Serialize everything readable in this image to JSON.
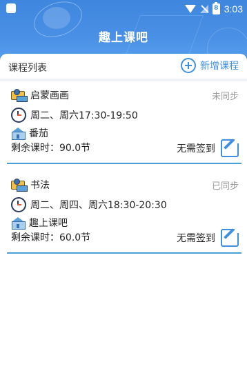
{
  "status_bar": {
    "time": "3:03",
    "battery_level": "8"
  },
  "header": {
    "title": "趣上课吧"
  },
  "list": {
    "title": "课程列表",
    "add_label": "新增课程"
  },
  "courses": [
    {
      "name": "启蒙画画",
      "sync_status": "未同步",
      "schedule": "周二、周六17:30-19:50",
      "school": "番茄",
      "remaining": "剩余课时：90.0节",
      "sign_label": "无需签到"
    },
    {
      "name": "书法",
      "sync_status": "已同步",
      "schedule": "周二、周四、周六18:30-20:30",
      "school": "趣上课吧",
      "remaining": "剩余课时：60.0节",
      "sign_label": "无需签到"
    }
  ],
  "colors": {
    "header": "#4a90e6",
    "accent": "#3f8fe0",
    "underline": "#4a9fd6"
  }
}
